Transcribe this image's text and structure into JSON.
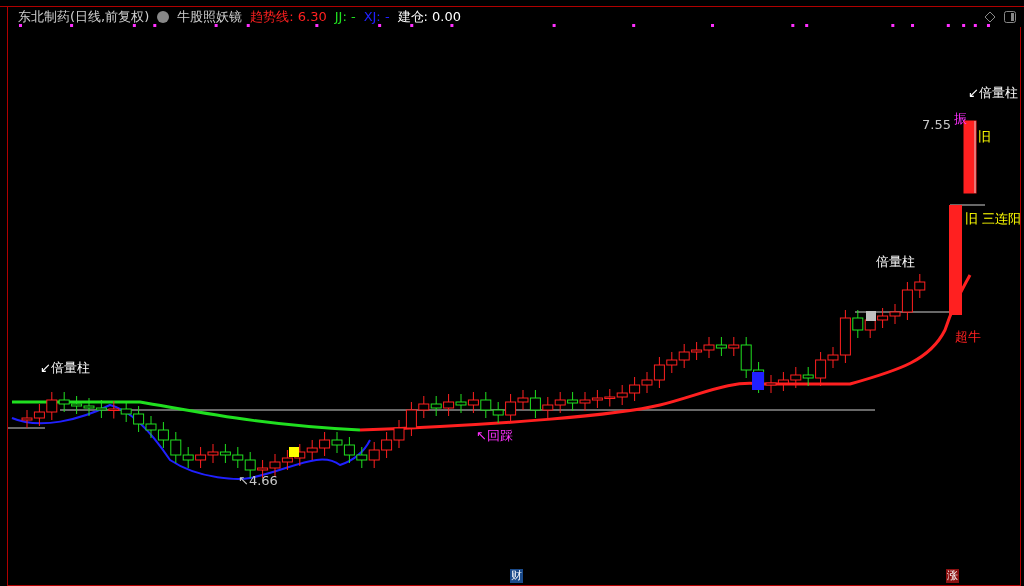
{
  "header": {
    "title": "东北制药(日线,前复权)",
    "indicator": "牛股照妖镜",
    "readings": [
      {
        "kind": "trend",
        "text": "趋势线: 6.30"
      },
      {
        "kind": "jj",
        "text": "JJ: -"
      },
      {
        "kind": "xj",
        "text": "XJ: -"
      },
      {
        "kind": "position",
        "text": "建仓: 0.00"
      }
    ]
  },
  "annotations": [
    {
      "kind": "volume",
      "text": "↙倍量柱"
    },
    {
      "kind": "price",
      "text": "7.55"
    },
    {
      "kind": "signal",
      "text": "振"
    },
    {
      "kind": "marker",
      "text": "旧"
    },
    {
      "kind": "volume",
      "text": "倍量柱"
    },
    {
      "kind": "marker",
      "text": "旧 三连阳"
    },
    {
      "kind": "bull",
      "text": "超牛"
    },
    {
      "kind": "volume",
      "text": "↙倍量柱"
    },
    {
      "kind": "signal",
      "text": "↖回踩"
    },
    {
      "kind": "price",
      "text": "↖4.66"
    }
  ],
  "footer_badges": [
    {
      "kind": "finance",
      "text": "财"
    },
    {
      "kind": "rise",
      "text": "涨"
    }
  ]
}
